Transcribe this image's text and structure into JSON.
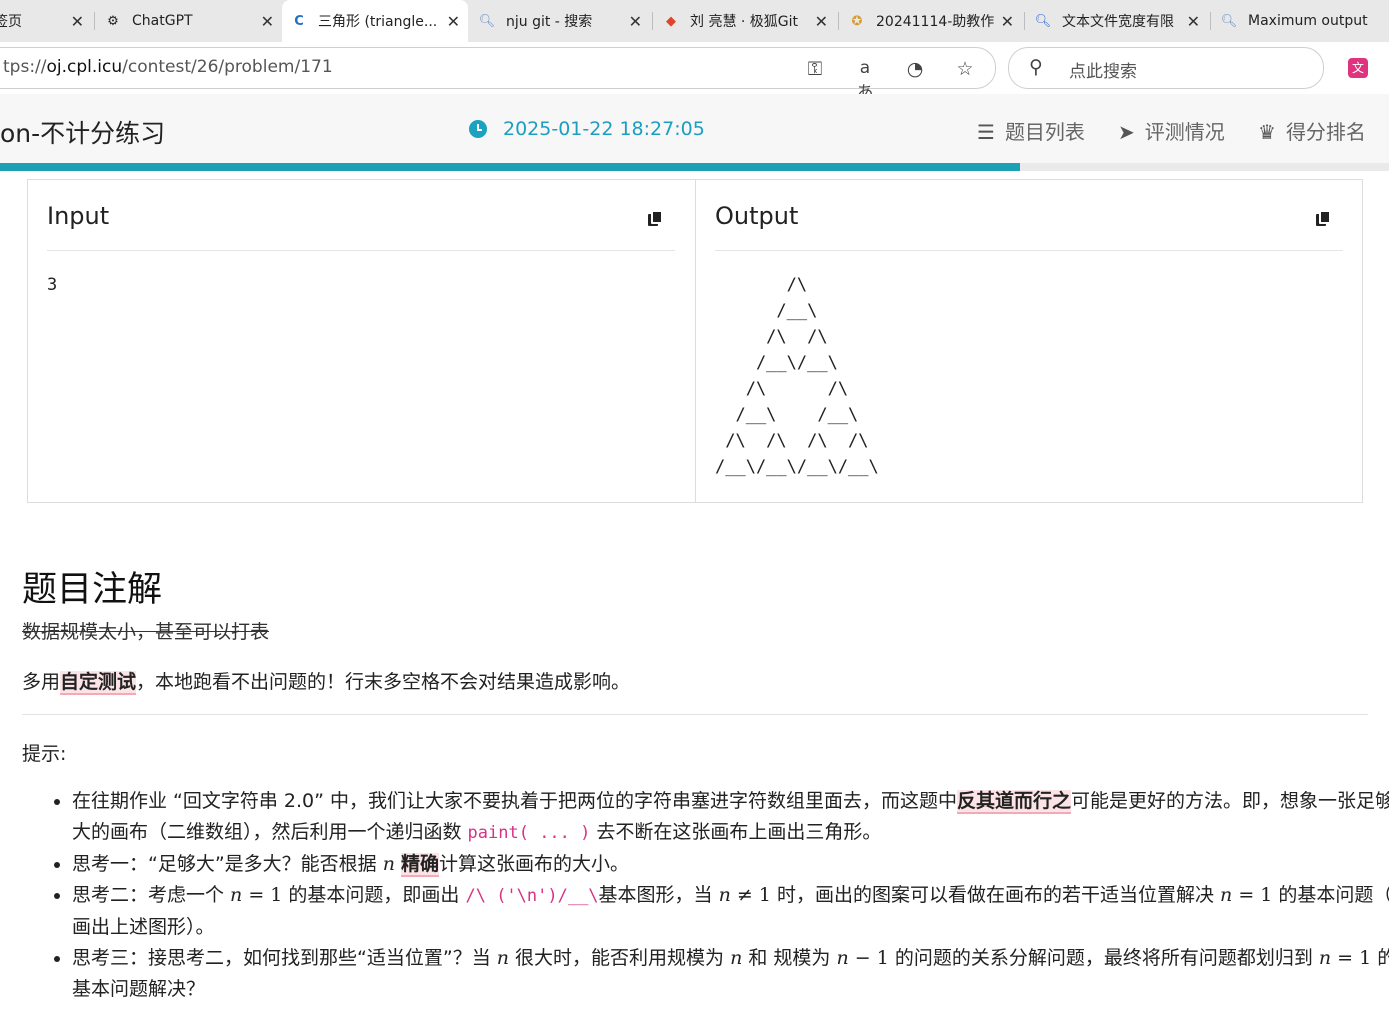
{
  "browser": {
    "tabs": [
      {
        "title": "签页",
        "icon": "new-tab-icon"
      },
      {
        "title": "ChatGPT",
        "icon": "chatgpt-icon"
      },
      {
        "title": "三角形 (triangle...",
        "icon": "oj-icon",
        "active": true
      },
      {
        "title": "nju git - 搜索",
        "icon": "search-icon"
      },
      {
        "title": "刘 亮慧 · 极狐Git",
        "icon": "gitlab-icon"
      },
      {
        "title": "20241114-助教作",
        "icon": "medal-icon"
      },
      {
        "title": "文本文件宽度有限",
        "icon": "search-icon"
      },
      {
        "title": "Maximum output",
        "icon": "search-icon"
      }
    ],
    "url_prefix": "tps://",
    "url_host": "oj.cpl.icu",
    "url_path": "/contest/26/problem/171",
    "search_placeholder": "点此搜索"
  },
  "header": {
    "contest_title": "on-不计分练习",
    "time": "2025-01-22 18:27:05",
    "nav": [
      {
        "label": "题目列表",
        "icon": "list-icon"
      },
      {
        "label": "评测情况",
        "icon": "paper-plane-icon"
      },
      {
        "label": "得分排名",
        "icon": "trophy-icon"
      }
    ],
    "progress": 0.734
  },
  "sample": {
    "input_title": "Input",
    "input_text": "3",
    "output_title": "Output",
    "output_text": "       /\\\n      /__\\\n     /\\  /\\\n    /__\\/__\\\n   /\\      /\\\n  /__\\    /__\\\n /\\  /\\  /\\  /\\\n/__\\/__\\/__\\/__\\"
  },
  "notes": {
    "heading": "题目注解",
    "struck": "数据规模太小，甚至可以打表",
    "para_pre": "多用",
    "para_hl": "自定测试",
    "para_post": "，本地跑看不出问题的！行末多空格不会对结果造成影响。",
    "tip_label": "提示:",
    "hints": {
      "h1_a": "在往期作业 “回文字符串 2.0” 中，我们让大家不要执着于把两位的字符串塞进字符数组里面去，而这题中",
      "h1_hl": "反其道而行之",
      "h1_b": "可能是更好的方法。即，想象一张足够大的画布（二维数组），然后利用一个递归函数 ",
      "h1_code": "paint( ... )",
      "h1_c": " 去不断在这张画布上画出三角形。",
      "h2_a": "思考一：“足够大”是多大？能否根据 ",
      "h2_n": "n",
      "h2_hl": "精确",
      "h2_b": "计算这张画布的大小。",
      "h3_a": "思考二：考虑一个 ",
      "h3_n1": "n",
      "h3_eq1": " = 1",
      "h3_b": " 的基本问题，即画出 ",
      "h3_code": "/\\ ('\\n')/__\\",
      "h3_c": "基本图形，当 ",
      "h3_n2": "n",
      "h3_ne": " ≠ 1",
      "h3_d": " 时，画出的图案可以看做在画布的若干适当位置解决 ",
      "h3_n3": "n",
      "h3_eq3": " = 1",
      "h3_e": " 的基本问题（即画出上述图形）。",
      "h4_a": "思考三：接思考二，如何找到那些“适当位置”？当 ",
      "h4_n1": "n",
      "h4_b": " 很大时，能否利用规模为 ",
      "h4_n2": "n",
      "h4_c": " 和 规模为 ",
      "h4_n3": "n",
      "h4_m": " − 1",
      "h4_d": " 的问题的关系分解问题，最终将所有问题都划归到 ",
      "h4_n4": "n",
      "h4_eq": " = 1",
      "h4_e": " 的基本问题解决？"
    }
  }
}
